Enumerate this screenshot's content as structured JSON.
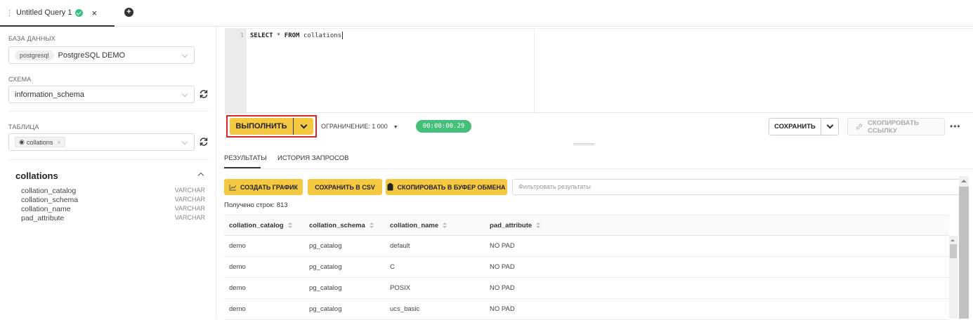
{
  "tab": {
    "title": "Untitled Query 1",
    "close": "×",
    "add": "+"
  },
  "sidebar": {
    "database_label": "БАЗА ДАННЫХ",
    "database_engine": "postgresql",
    "database_name": "PostgreSQL DEMO",
    "schema_label": "СХЕМА",
    "schema_value": "information_schema",
    "table_label": "ТАБЛИЦА",
    "table_value": "collations",
    "table_title": "collations",
    "columns": [
      {
        "name": "collation_catalog",
        "type": "VARCHAR"
      },
      {
        "name": "collation_schema",
        "type": "VARCHAR"
      },
      {
        "name": "collation_name",
        "type": "VARCHAR"
      },
      {
        "name": "pad_attribute",
        "type": "VARCHAR"
      }
    ]
  },
  "editor": {
    "line_number": "1",
    "kw_select": "SELECT",
    "star": " * ",
    "kw_from": "FROM",
    "table": " collations"
  },
  "toolbar": {
    "run_label": "ВЫПОЛНИТЬ",
    "limit_label": "ОГРАНИЧЕНИЕ: 1 000",
    "timer": "00:00:00.29",
    "save_label": "СОХРАНИТЬ",
    "copy_link_label": "СКОПИРОВАТЬ ССЫЛКУ",
    "more": "•••"
  },
  "result_tabs": {
    "results": "РЕЗУЛЬТАТЫ",
    "history": "ИСТОРИЯ ЗАПРОСОВ"
  },
  "result_actions": {
    "chart": "СОЗДАТЬ ГРАФИК",
    "csv": "СОХРАНИТЬ В CSV",
    "clipboard": "СКОПИРОВАТЬ В БУФЕР ОБМЕНА",
    "filter_placeholder": "Фильтровать результаты",
    "row_count": "Получено строк: 813"
  },
  "table": {
    "headers": [
      "collation_catalog",
      "collation_schema",
      "collation_name",
      "pad_attribute"
    ],
    "rows": [
      [
        "demo",
        "pg_catalog",
        "default",
        "NO PAD"
      ],
      [
        "demo",
        "pg_catalog",
        "C",
        "NO PAD"
      ],
      [
        "demo",
        "pg_catalog",
        "POSIX",
        "NO PAD"
      ],
      [
        "demo",
        "pg_catalog",
        "ucs_basic",
        "NO PAD"
      ]
    ]
  },
  "colors": {
    "accent": "#f5c842",
    "success": "#45c07a",
    "highlight": "#d62828"
  }
}
